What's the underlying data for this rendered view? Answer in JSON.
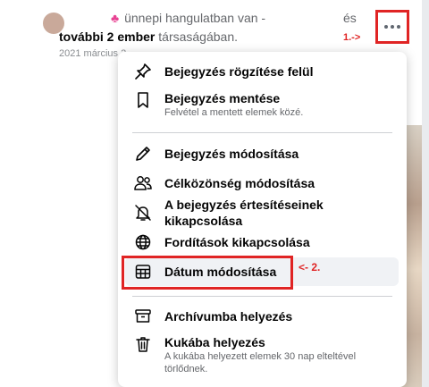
{
  "post": {
    "emoji": "♣",
    "line1": "ünnepi hangulatban van -",
    "line1_es": "és",
    "line2_bold": "további 2 ember",
    "line2_rest": " társaságában.",
    "date_partial": "2021 március 2"
  },
  "annotations": {
    "step1": "1.->",
    "step2": "<- 2."
  },
  "menu": {
    "pin": {
      "label": "Bejegyzés rögzítése felül",
      "icon": "pin-icon"
    },
    "save": {
      "label": "Bejegyzés mentése",
      "sub": "Felvétel a mentett elemek közé.",
      "icon": "bookmark-icon"
    },
    "edit": {
      "label": "Bejegyzés módosítása",
      "icon": "pencil-icon"
    },
    "audience": {
      "label": "Célközönség módosítása",
      "icon": "people-icon"
    },
    "notifications": {
      "label": "A bejegyzés értesítéseinek kikapcsolása",
      "icon": "bell-off-icon"
    },
    "translations": {
      "label": "Fordítások kikapcsolása",
      "icon": "globe-icon"
    },
    "date": {
      "label": "Dátum módosítása",
      "icon": "calendar-icon"
    },
    "archive": {
      "label": "Archívumba helyezés",
      "icon": "archive-icon"
    },
    "trash": {
      "label": "Kukába helyezés",
      "sub": "A kukába helyezett elemek 30 nap elteltével törlődnek.",
      "icon": "trash-icon"
    }
  },
  "colors": {
    "annotation_red": "#e02424",
    "highlight_bg": "#f0f2f5",
    "text_primary": "#050505",
    "text_secondary": "#65676b"
  }
}
